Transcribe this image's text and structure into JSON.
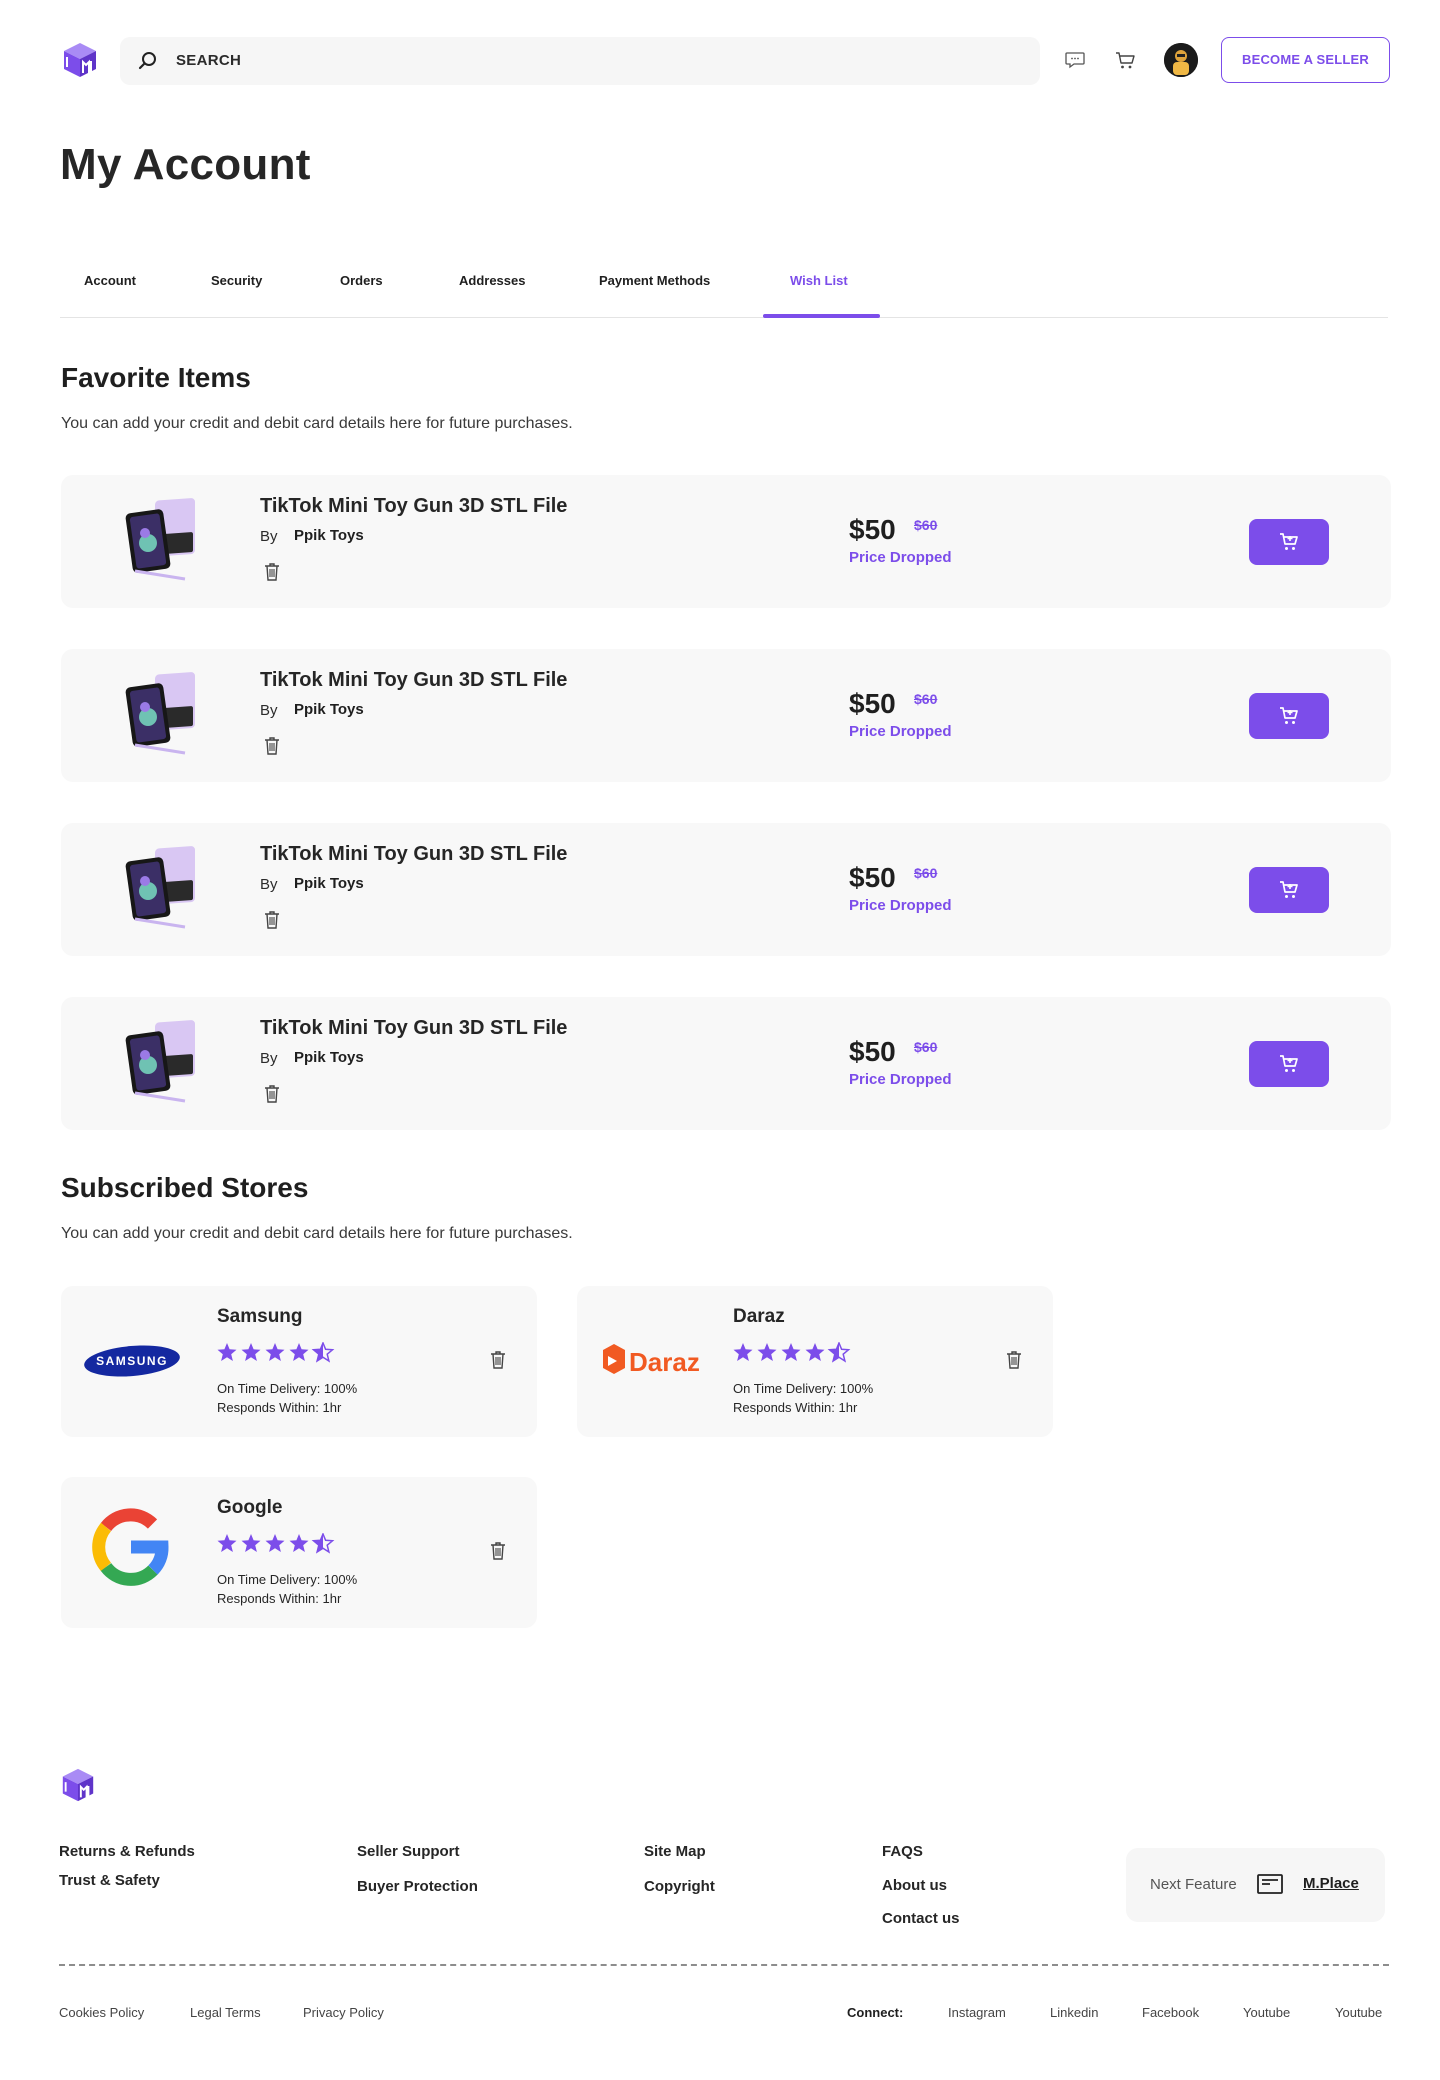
{
  "header": {
    "search_placeholder": "SEARCH",
    "become_seller_label": "BECOME A SELLER"
  },
  "page": {
    "title": "My Account"
  },
  "tabs": [
    {
      "label": "Account"
    },
    {
      "label": "Security"
    },
    {
      "label": "Orders"
    },
    {
      "label": "Addresses"
    },
    {
      "label": "Payment Methods"
    },
    {
      "label": "Wish List",
      "active": true
    }
  ],
  "favorites": {
    "title": "Favorite Items",
    "subtitle": "You can add your credit and debit card details here for future purchases.",
    "items": [
      {
        "name": "TikTok Mini Toy Gun 3D STL File",
        "by": "By",
        "store": "Ppik Toys",
        "price": "$50",
        "old_price": "$60",
        "status": "Price Dropped"
      },
      {
        "name": "TikTok Mini Toy Gun 3D STL File",
        "by": "By",
        "store": "Ppik Toys",
        "price": "$50",
        "old_price": "$60",
        "status": "Price Dropped"
      },
      {
        "name": "TikTok Mini Toy Gun 3D STL File",
        "by": "By",
        "store": "Ppik Toys",
        "price": "$50",
        "old_price": "$60",
        "status": "Price Dropped"
      },
      {
        "name": "TikTok Mini Toy Gun 3D STL File",
        "by": "By",
        "store": "Ppik Toys",
        "price": "$50",
        "old_price": "$60",
        "status": "Price Dropped"
      }
    ]
  },
  "stores": {
    "title": "Subscribed Stores",
    "subtitle": "You can add your credit and debit card details here for future purchases.",
    "items": [
      {
        "name": "Samsung",
        "logo_text": "SAMSUNG",
        "rating": 4.5,
        "delivery": "On Time Delivery: 100%",
        "responds": "Responds Within: 1hr"
      },
      {
        "name": "Daraz",
        "logo_text": "Daraz",
        "rating": 4.5,
        "delivery": "On Time Delivery: 100%",
        "responds": "Responds Within: 1hr"
      },
      {
        "name": "Google",
        "rating": 4.5,
        "delivery": "On Time Delivery: 100%",
        "responds": "Responds Within: 1hr"
      }
    ]
  },
  "footer": {
    "col1": [
      "Returns & Refunds",
      "Trust & Safety"
    ],
    "col2": [
      "Seller Support",
      "Buyer Protection"
    ],
    "col3": [
      "Site Map",
      "Copyright"
    ],
    "col4": [
      "FAQS",
      "About us",
      "Contact us"
    ],
    "next_feature": {
      "label": "Next Feature",
      "brand": "M.Place"
    },
    "legal": [
      "Cookies Policy",
      "Legal Terms",
      "Privacy Policy"
    ],
    "connect_label": "Connect:",
    "social": [
      "Instagram",
      "Linkedin",
      "Facebook",
      "Youtube",
      "Youtube"
    ]
  },
  "colors": {
    "accent": "#7c4dea",
    "card_bg": "#f8f8f8",
    "text": "#1f1f1f"
  }
}
